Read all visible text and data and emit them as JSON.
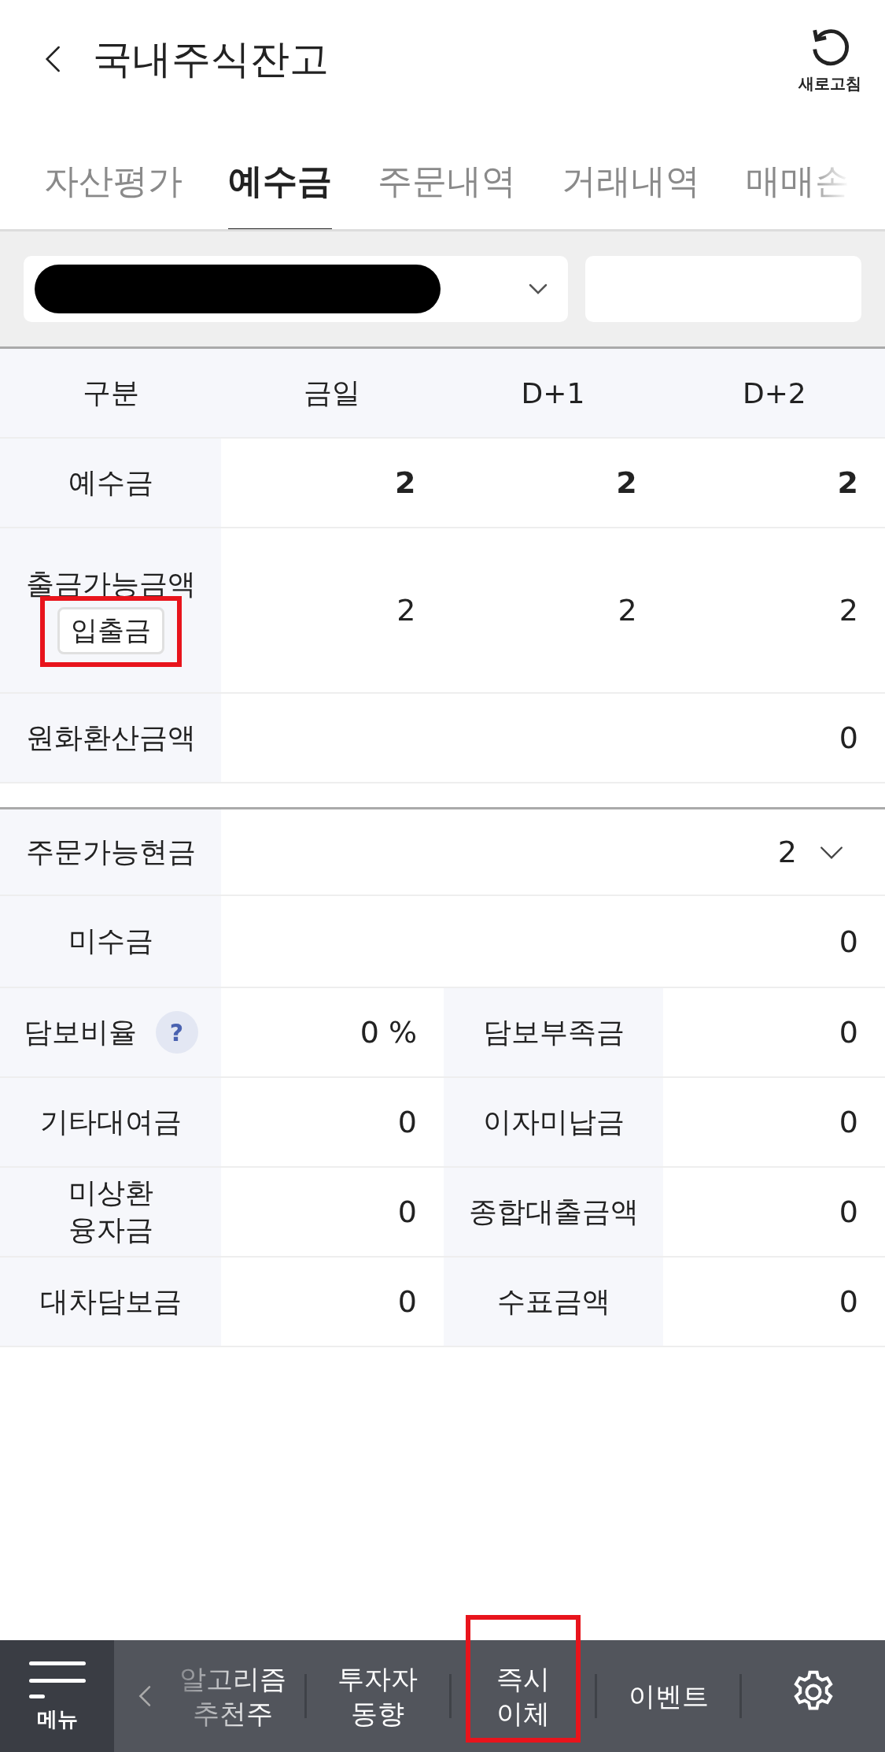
{
  "header": {
    "title": "국내주식잔고",
    "refresh_label": "새로고침"
  },
  "tabs": [
    {
      "label": "자산평가",
      "selected": false
    },
    {
      "label": "예수금",
      "selected": true
    },
    {
      "label": "주문내역",
      "selected": false
    },
    {
      "label": "거래내역",
      "selected": false
    },
    {
      "label": "매매손",
      "selected": false
    }
  ],
  "account_select": {
    "redacted": true
  },
  "deposit_table": {
    "columns": [
      "구분",
      "금일",
      "D+1",
      "D+2"
    ],
    "rows": [
      {
        "label": "예수금",
        "values": [
          "2",
          "2",
          "2"
        ],
        "emphasis": true
      },
      {
        "label": "출금가능금액",
        "button": {
          "label": "입출금",
          "highlighted": true
        },
        "values": [
          "2",
          "2",
          "2"
        ],
        "emphasis": false
      },
      {
        "label": "원화환산금액",
        "values": [
          "0"
        ],
        "emphasis": false
      }
    ]
  },
  "order_table": {
    "orderable": {
      "label": "주문가능현금",
      "value": "2",
      "expanded": false
    },
    "rows": [
      {
        "kind": "single",
        "label": "미수금",
        "value": "0"
      },
      {
        "kind": "pair",
        "cells": [
          {
            "label": "담보비율",
            "value": "0 %",
            "help": "?"
          },
          {
            "label": "담보부족금",
            "value": "0"
          }
        ]
      },
      {
        "kind": "pair",
        "cells": [
          {
            "label": "기타대여금",
            "value": "0"
          },
          {
            "label": "이자미납금",
            "value": "0"
          }
        ]
      },
      {
        "kind": "pair",
        "cells": [
          {
            "label": "미상환\n융자금",
            "value": "0"
          },
          {
            "label": "종합대출금액",
            "value": "0"
          }
        ]
      },
      {
        "kind": "pair",
        "cells": [
          {
            "label": "대차담보금",
            "value": "0"
          },
          {
            "label": "수표금액",
            "value": "0"
          }
        ]
      }
    ]
  },
  "bottom_nav": {
    "menu_label": "메뉴",
    "items": [
      {
        "kind": "text",
        "label": "알고리즘\n추천주",
        "faded": true,
        "highlighted": false
      },
      {
        "kind": "text",
        "label": "투자자\n동향",
        "faded": false,
        "highlighted": false
      },
      {
        "kind": "text",
        "label": "즉시\n이체",
        "faded": false,
        "highlighted": true
      },
      {
        "kind": "text",
        "label": "이벤트",
        "faded": false,
        "highlighted": false
      },
      {
        "kind": "settings",
        "faded": false,
        "highlighted": false
      }
    ]
  }
}
